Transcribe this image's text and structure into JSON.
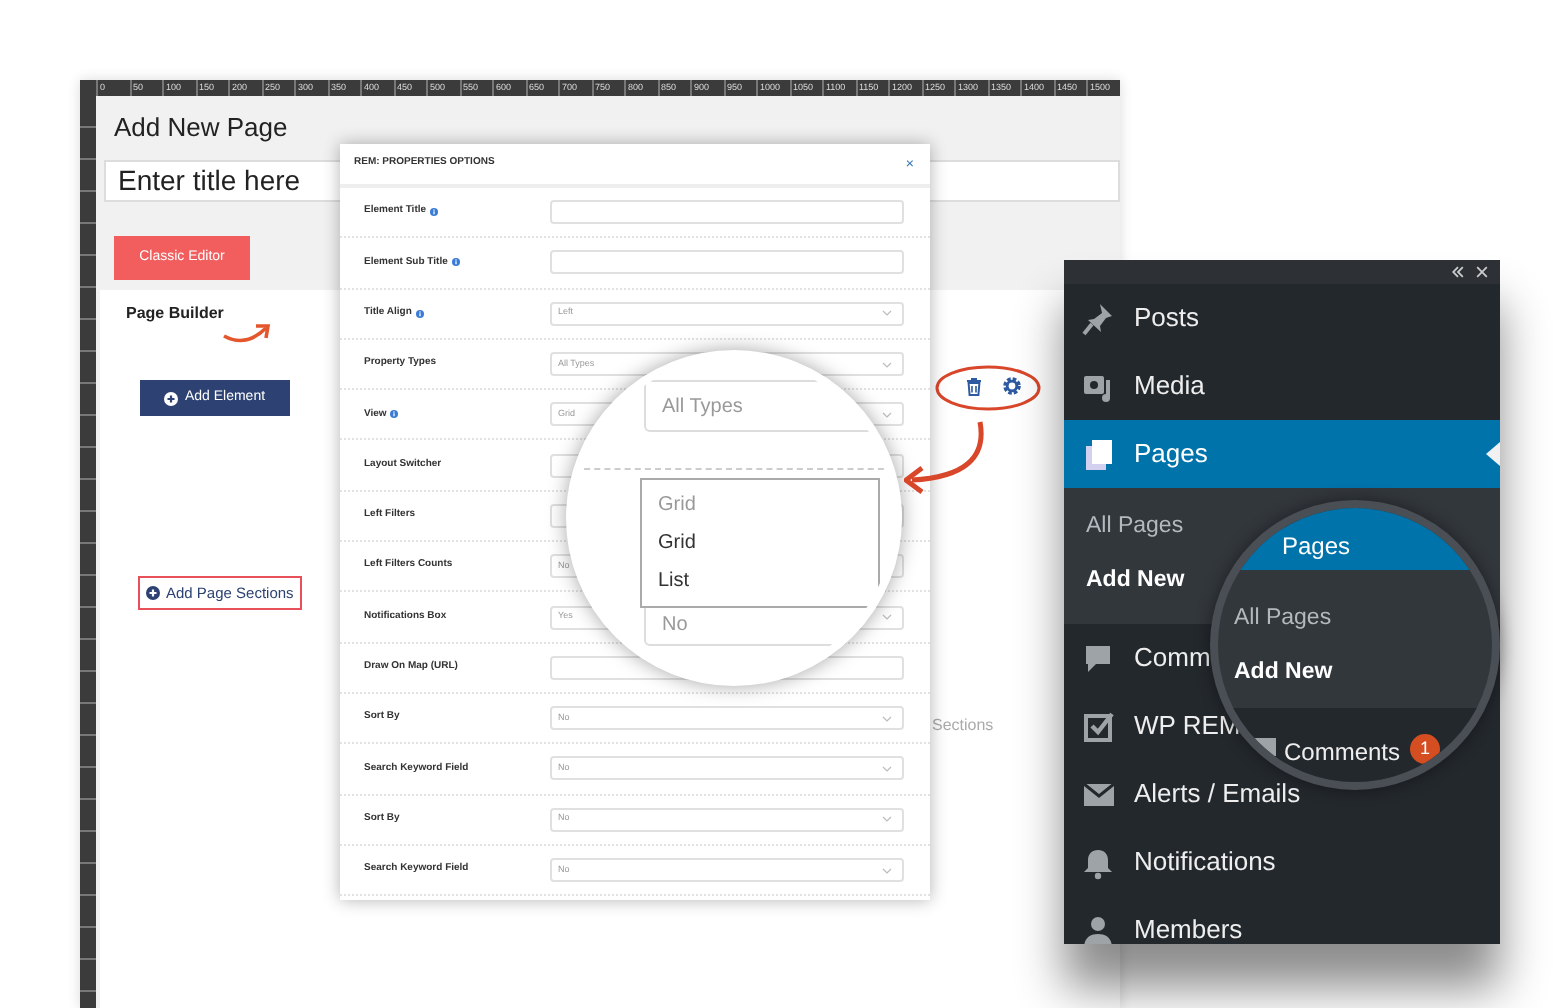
{
  "ruler": {
    "marks": [
      "0",
      "50",
      "100",
      "150",
      "200",
      "250",
      "300",
      "350",
      "400",
      "450",
      "500",
      "550",
      "600",
      "650",
      "700",
      "750",
      "800",
      "850",
      "900",
      "950",
      "1000",
      "1050",
      "1100",
      "1150",
      "1200",
      "1250",
      "1300",
      "1350",
      "1400",
      "1450",
      "1500"
    ]
  },
  "builder": {
    "title": "Add New Page",
    "title_field": {
      "placeholder": "Enter title here"
    },
    "classic_editor_button": "Classic Editor",
    "section_title": "Page Builder",
    "add_element_button": "Add Element",
    "add_sections_link": "Add Page Sections",
    "hidden_text": "Sections"
  },
  "modal": {
    "title": "REM: PROPERTIES OPTIONS",
    "close": "×",
    "rows": [
      {
        "label": "Element Title",
        "info": true,
        "kind": "text"
      },
      {
        "label": "Element Sub Title",
        "info": true,
        "kind": "text"
      },
      {
        "label": "Title Align",
        "info": true,
        "kind": "select",
        "value": "Left"
      },
      {
        "label": "Property Types",
        "info": false,
        "kind": "select",
        "value": "All Types"
      },
      {
        "label": "View",
        "info": true,
        "kind": "select",
        "value": "Grid"
      },
      {
        "label": "Layout Switcher",
        "info": false,
        "kind": "select"
      },
      {
        "label": "Left Filters",
        "info": false,
        "kind": "select"
      },
      {
        "label": "Left Filters Counts",
        "info": false,
        "kind": "select",
        "value": "No"
      },
      {
        "label": "Notifications Box",
        "info": false,
        "kind": "select",
        "value": "Yes"
      },
      {
        "label": "Draw On Map (URL)",
        "info": false,
        "kind": "text"
      },
      {
        "label": "Sort By",
        "info": false,
        "kind": "select",
        "value": "No"
      },
      {
        "label": "Search Keyword Field",
        "info": false,
        "kind": "select",
        "value": "No"
      },
      {
        "label": "Sort By",
        "info": false,
        "kind": "select",
        "value": "No"
      },
      {
        "label": "Search Keyword Field",
        "info": false,
        "kind": "select",
        "value": "No"
      }
    ]
  },
  "magnifier": {
    "select_value": "All Types",
    "dropdown_current": "Grid",
    "options": [
      {
        "label": "Grid"
      },
      {
        "label": "List"
      }
    ],
    "next_value": "No"
  },
  "admin_menu": {
    "items": [
      {
        "label": "Posts",
        "selected": false
      },
      {
        "label": "Media",
        "selected": false
      },
      {
        "label": "Pages",
        "selected": true,
        "submenu": [
          {
            "label": "All Pages",
            "selected": false
          },
          {
            "label": "Add New",
            "selected": true
          }
        ]
      },
      {
        "label": "Comm",
        "selected": false
      },
      {
        "label": "WP REM",
        "selected": false
      },
      {
        "label": "Alerts / Emails",
        "selected": false
      },
      {
        "label": "Notifications",
        "selected": false
      },
      {
        "label": "Members",
        "selected": false
      }
    ]
  },
  "menu_magnifier": {
    "header": "Pages",
    "submenu": [
      {
        "label": "All Pages",
        "selected": false
      },
      {
        "label": "Add New",
        "selected": true
      }
    ],
    "comments": {
      "label": "Comments",
      "badge": "1"
    }
  }
}
